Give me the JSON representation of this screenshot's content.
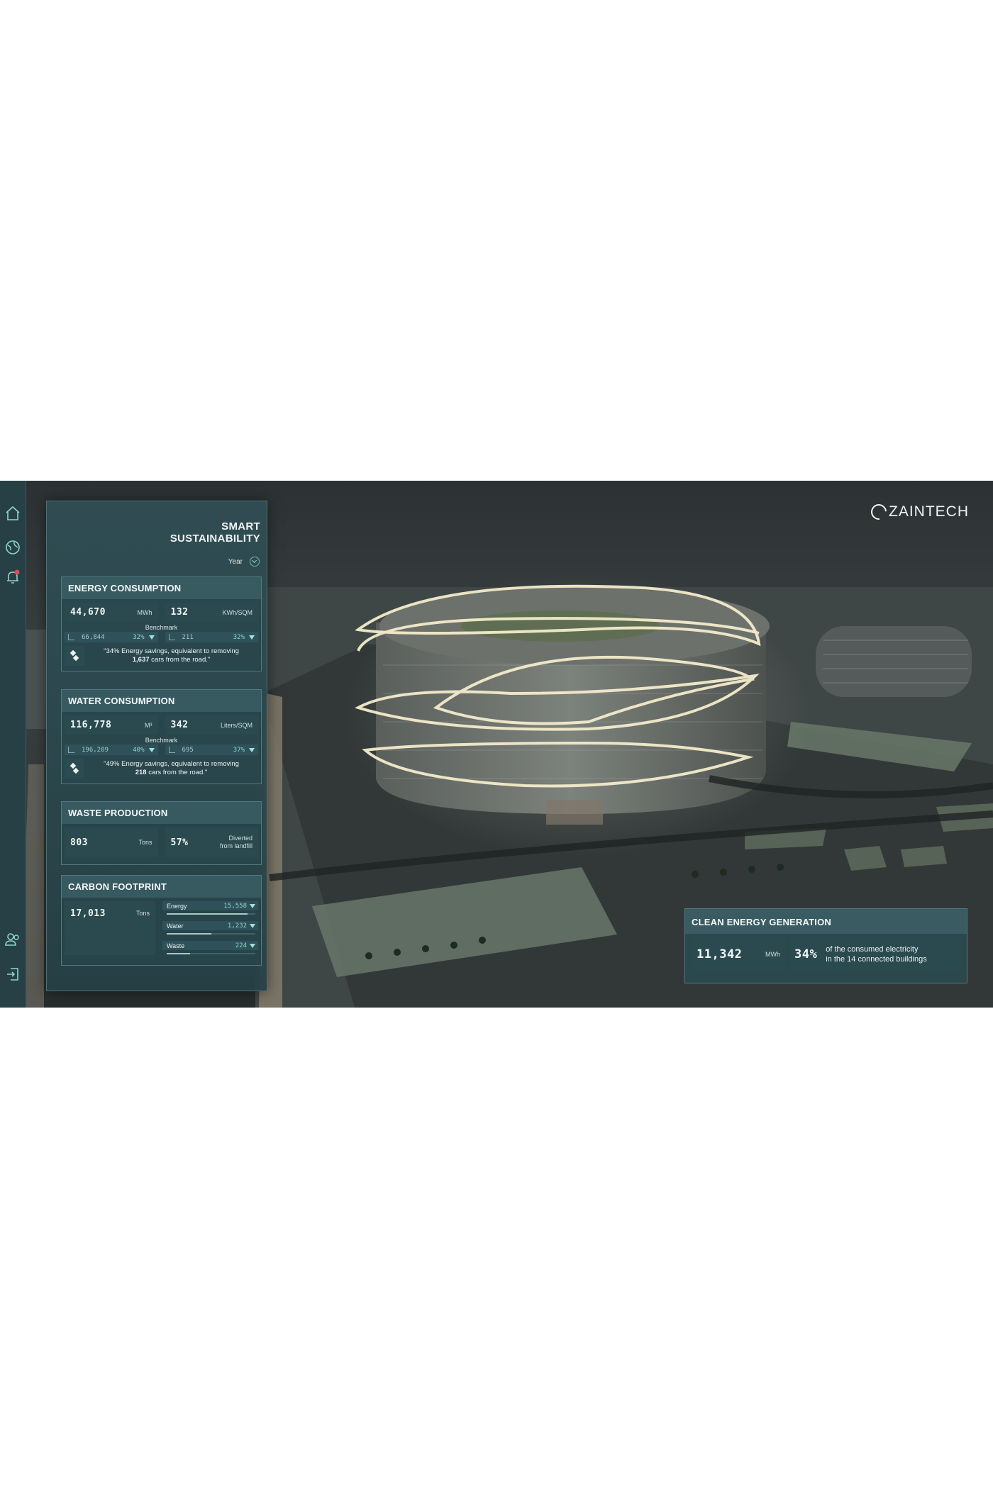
{
  "brand": {
    "logo_text": "ZAINTECH"
  },
  "panel": {
    "title_line1": "SMART",
    "title_line2": "SUSTAINABILITY",
    "period": "Year"
  },
  "energy": {
    "title": "ENERGY CONSUMPTION",
    "total": "44,670",
    "total_unit": "MWh",
    "intensity": "132",
    "intensity_unit": "KWh/SQM",
    "benchmark_label": "Benchmark",
    "bench_total": "66,844",
    "bench_total_pct": "32%",
    "bench_intensity": "211",
    "bench_intensity_pct": "32%",
    "quote_pre": "\"34% Energy savings, equivalent to removing",
    "quote_bold": "1,637",
    "quote_post": "cars from the road.\""
  },
  "water": {
    "title": "WATER CONSUMPTION",
    "total": "116,778",
    "total_unit": "M³",
    "intensity": "342",
    "intensity_unit": "Liters/SQM",
    "benchmark_label": "Benchmark",
    "bench_total": "196,209",
    "bench_total_pct": "40%",
    "bench_intensity": "695",
    "bench_intensity_pct": "37%",
    "quote_pre": "\"49% Energy savings, equivalent to removing",
    "quote_bold": "218",
    "quote_post": "cars from the road.\""
  },
  "waste": {
    "title": "WASTE PRODUCTION",
    "total": "803",
    "total_unit": "Tons",
    "diverted": "57%",
    "diverted_label_1": "Diverted",
    "diverted_label_2": "from landfill"
  },
  "carbon": {
    "title": "CARBON FOOTPRINT",
    "total": "17,013",
    "total_unit": "Tons",
    "items": [
      {
        "label": "Energy",
        "value": "15,558",
        "share": 0.91
      },
      {
        "label": "Water",
        "value": "1,232",
        "share": 0.5
      },
      {
        "label": "Waste",
        "value": "224",
        "share": 0.26
      }
    ]
  },
  "clean_energy": {
    "title": "CLEAN ENERGY GENERATION",
    "value": "11,342",
    "unit": "MWh",
    "pct": "34%",
    "desc_1": "of the consumed electricity",
    "desc_2": "in the 14 connected buildings"
  },
  "nav": [
    "home-icon",
    "globe-icon",
    "bell-alert-icon",
    "users-icon",
    "logout-icon"
  ]
}
